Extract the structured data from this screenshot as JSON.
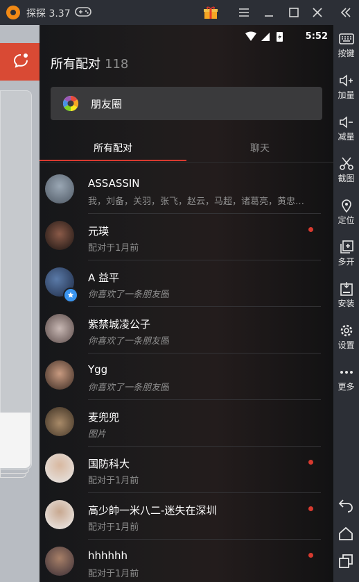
{
  "window": {
    "title": "探探 3.37"
  },
  "status_bar": {
    "time": "5:52"
  },
  "panel": {
    "header_title": "所有配对",
    "header_count": "118",
    "moments_label": "朋友圈",
    "tabs": [
      {
        "label": "所有配对",
        "active": true
      },
      {
        "label": "聊天",
        "active": false
      }
    ],
    "matches": [
      {
        "name": "ASSASSIN",
        "subtitle": "我，刘备，关羽，张飞，赵云，马超，诸葛亮，黄忠…",
        "italic": false,
        "unread": false,
        "verified": false,
        "avatar_color": "#6d7a88"
      },
      {
        "name": "元瑛",
        "subtitle": "配对于1月前",
        "italic": false,
        "unread": true,
        "verified": false,
        "avatar_color": "#3a2a26"
      },
      {
        "name": "A 益平",
        "subtitle": "你喜欢了一条朋友圈",
        "italic": true,
        "unread": false,
        "verified": true,
        "avatar_color": "#2a3a5c"
      },
      {
        "name": "紫禁城凌公子",
        "subtitle": "你喜欢了一条朋友圈",
        "italic": true,
        "unread": false,
        "verified": false,
        "avatar_color": "#8a7a78"
      },
      {
        "name": "Ygg",
        "subtitle": "你喜欢了一条朋友圈",
        "italic": true,
        "unread": false,
        "verified": false,
        "avatar_color": "#4a3a30"
      },
      {
        "name": "麦兜兜",
        "subtitle": "图片",
        "italic": true,
        "unread": false,
        "verified": false,
        "avatar_color": "#5a4a38"
      },
      {
        "name": "国防科大",
        "subtitle": "配对于1月前",
        "italic": false,
        "unread": true,
        "verified": false,
        "avatar_color": "#d8d8d8"
      },
      {
        "name": "高少帥一米八二-迷失在深圳",
        "subtitle": "配对于1月前",
        "italic": false,
        "unread": true,
        "verified": false,
        "avatar_color": "#c8c8c8"
      },
      {
        "name": "hhhhhh",
        "subtitle": "配对于1月前",
        "italic": false,
        "unread": true,
        "verified": false,
        "avatar_color": "#4a4048"
      }
    ]
  },
  "sidebar": {
    "items": [
      {
        "label": "按键",
        "icon": "keyboard-icon"
      },
      {
        "label": "加量",
        "icon": "volume-up-icon"
      },
      {
        "label": "减量",
        "icon": "volume-down-icon"
      },
      {
        "label": "截图",
        "icon": "scissors-icon"
      },
      {
        "label": "定位",
        "icon": "location-icon"
      },
      {
        "label": "多开",
        "icon": "multi-open-icon"
      },
      {
        "label": "安装",
        "icon": "apk-install-icon"
      },
      {
        "label": "设置",
        "icon": "gear-icon"
      },
      {
        "label": "更多",
        "icon": "more-icon"
      }
    ]
  },
  "colors": {
    "accent": "#d93a30",
    "chrome": "#2c2f36",
    "brand_orange": "#f28a15",
    "verified_blue": "#3a95f0"
  }
}
